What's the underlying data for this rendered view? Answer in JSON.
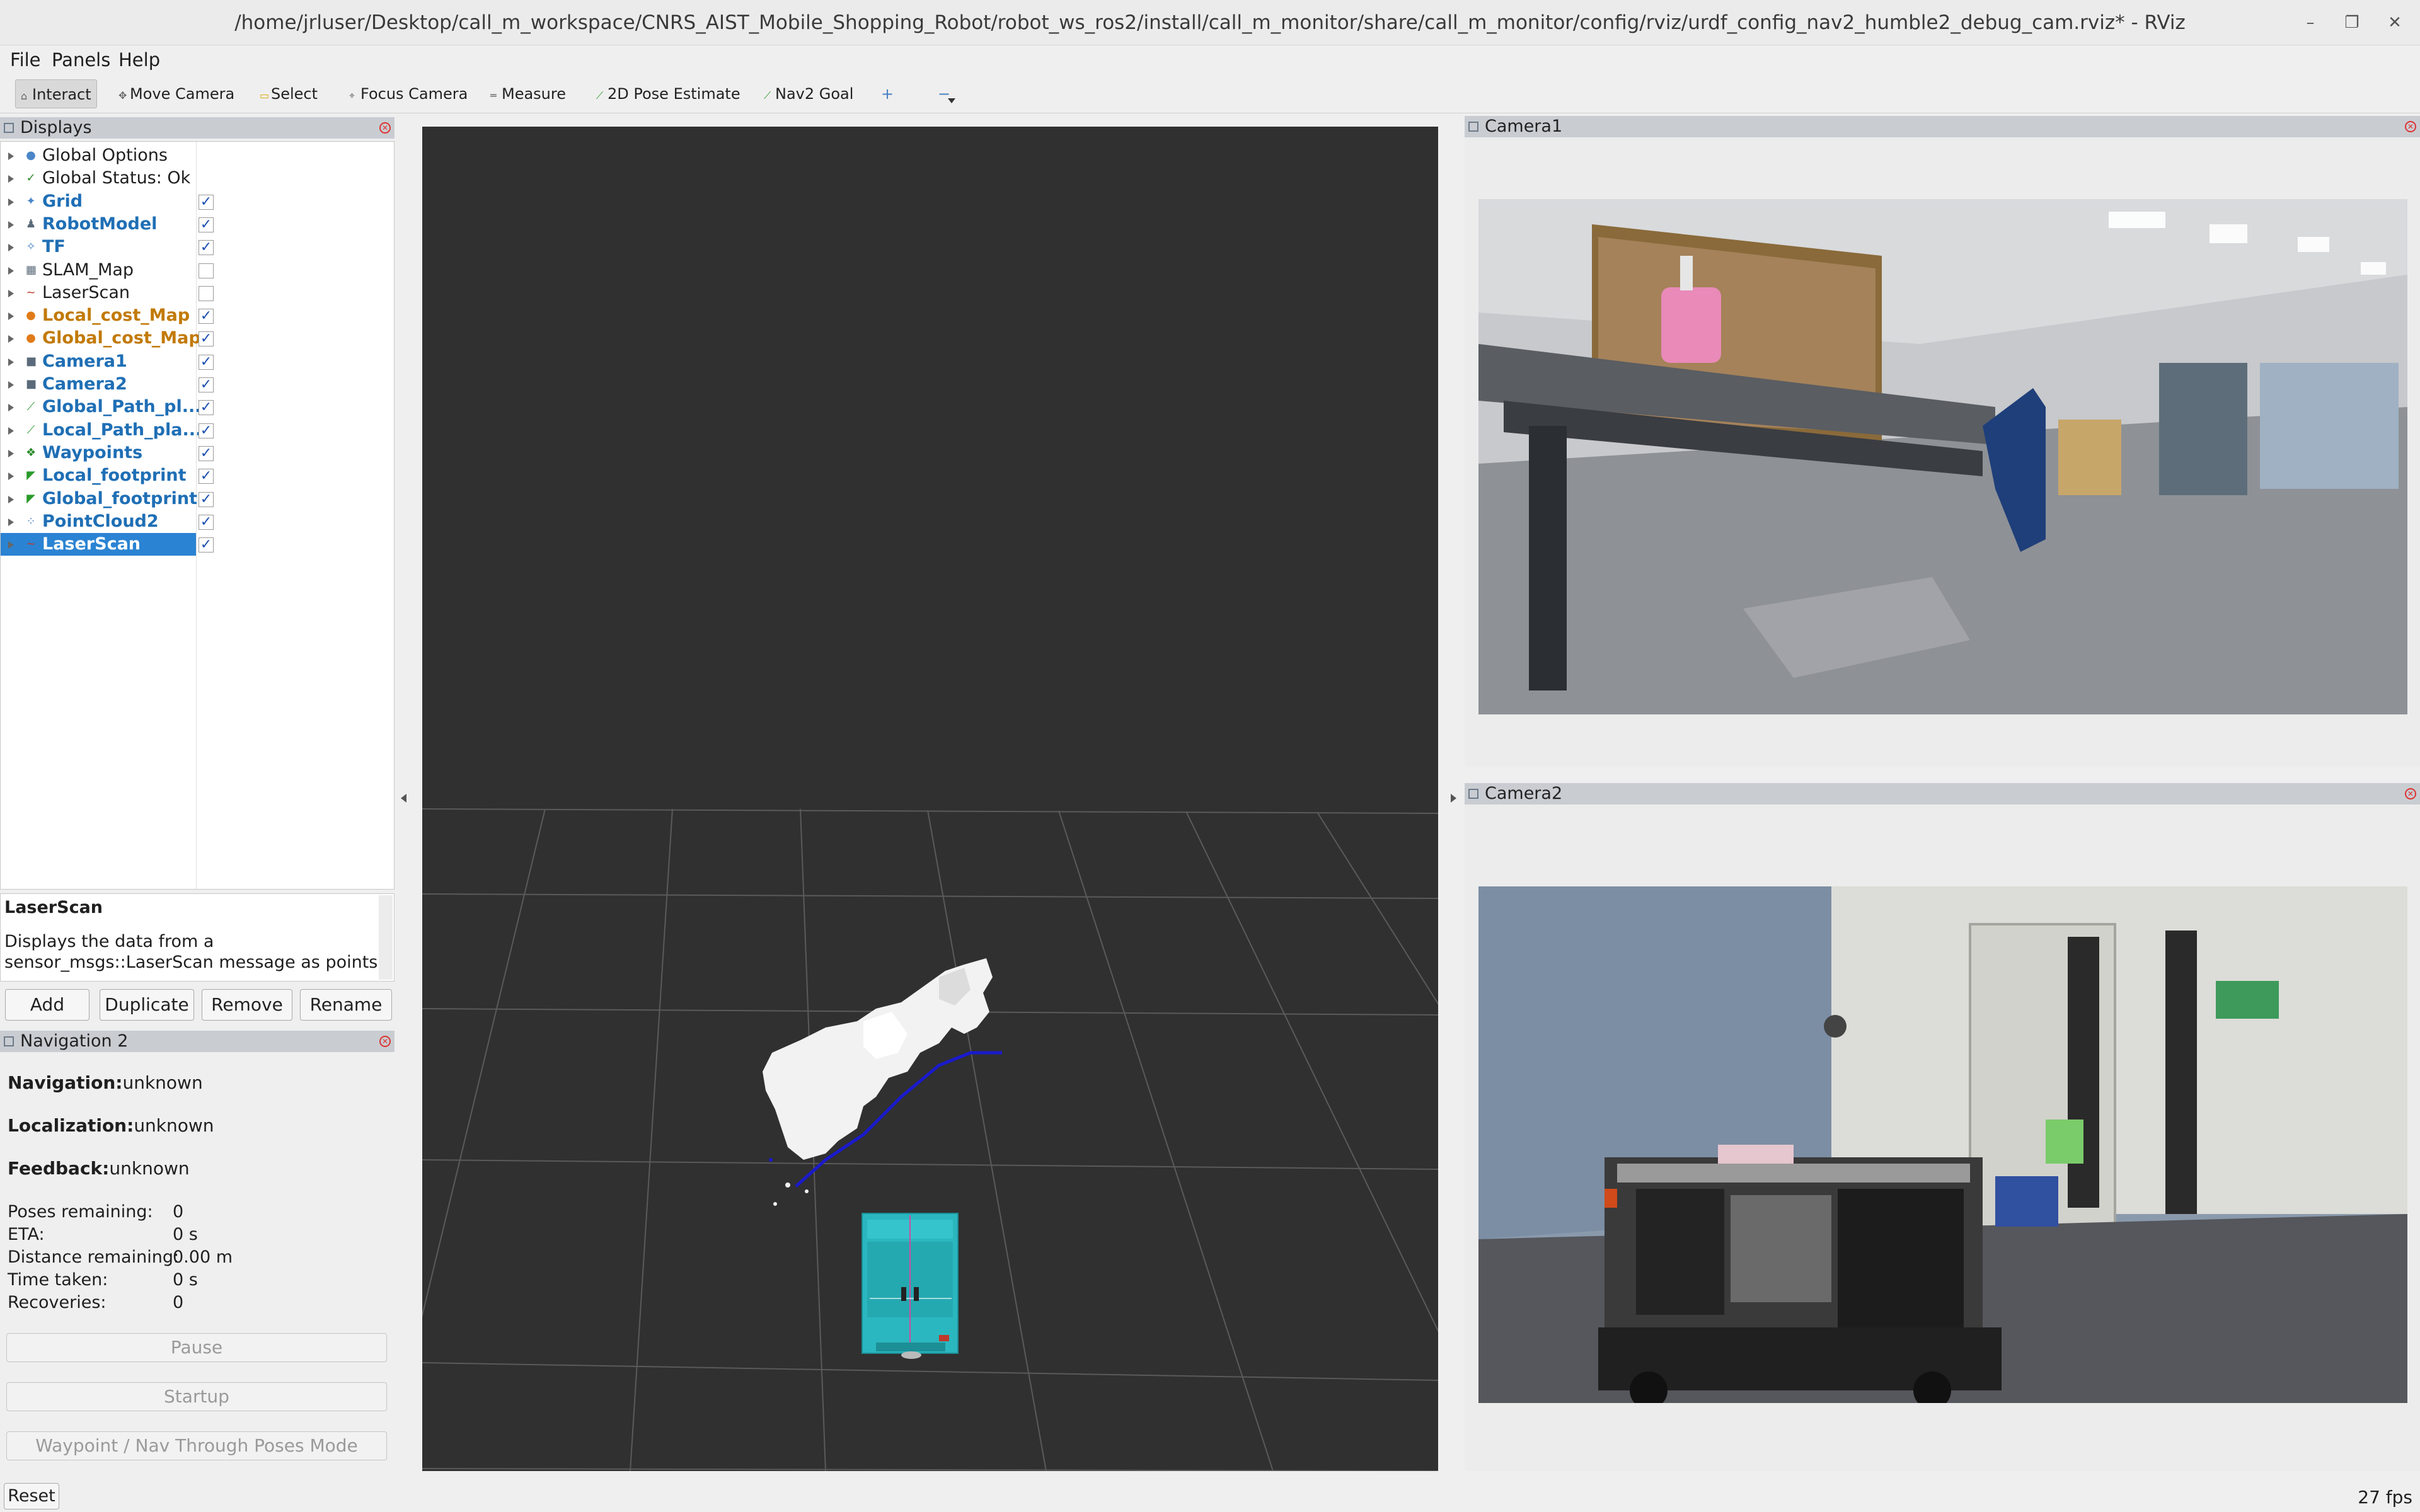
{
  "window": {
    "title": "/home/jrluser/Desktop/call_m_workspace/CNRS_AIST_Mobile_Shopping_Robot/robot_ws_ros2/install/call_m_monitor/share/call_m_monitor/config/rviz/urdf_config_nav2_humble2_debug_cam.rviz* - RViz",
    "minimize": "–",
    "restore": "❐",
    "close": "✕"
  },
  "menu": {
    "file": "File",
    "panels": "Panels",
    "help": "Help"
  },
  "toolbar": {
    "interact": "Interact",
    "move_camera": "Move Camera",
    "select": "Select",
    "focus_camera": "Focus Camera",
    "measure": "Measure",
    "pose_estimate": "2D Pose Estimate",
    "nav2_goal": "Nav2 Goal",
    "plus": "+",
    "minus": "−"
  },
  "displays": {
    "header": "Displays",
    "items": [
      {
        "label": "Global Options",
        "icon": "●",
        "icon_color": "#4a86c8",
        "bold": false,
        "color": "#1f1f1f",
        "check": null
      },
      {
        "label": "Global Status: Ok",
        "icon": "✓",
        "icon_color": "#2a8a2a",
        "bold": false,
        "color": "#1f1f1f",
        "check": null
      },
      {
        "label": "Grid",
        "icon": "✦",
        "icon_color": "#4a86c8",
        "bold": true,
        "color": "#1f6fb5",
        "check": "✓"
      },
      {
        "label": "RobotModel",
        "icon": "♟",
        "icon_color": "#5a6a7a",
        "bold": true,
        "color": "#1f6fb5",
        "check": "✓"
      },
      {
        "label": "TF",
        "icon": "✧",
        "icon_color": "#4a86c8",
        "bold": true,
        "color": "#1f6fb5",
        "check": "✓"
      },
      {
        "label": "SLAM_Map",
        "icon": "▦",
        "icon_color": "#5a6a7a",
        "bold": false,
        "color": "#1f1f1f",
        "check": ""
      },
      {
        "label": "LaserScan",
        "icon": "~",
        "icon_color": "#c0392b",
        "bold": false,
        "color": "#1f1f1f",
        "check": ""
      },
      {
        "label": "Local_cost_Map",
        "icon": "●",
        "icon_color": "#e07b1a",
        "bold": true,
        "color": "#c27a08",
        "check": "✓"
      },
      {
        "label": "Global_cost_Map",
        "icon": "●",
        "icon_color": "#e07b1a",
        "bold": true,
        "color": "#c27a08",
        "check": "✓"
      },
      {
        "label": "Camera1",
        "icon": "■",
        "icon_color": "#5a6a7a",
        "bold": true,
        "color": "#1f6fb5",
        "check": "✓"
      },
      {
        "label": "Camera2",
        "icon": "■",
        "icon_color": "#5a6a7a",
        "bold": true,
        "color": "#1f6fb5",
        "check": "✓"
      },
      {
        "label": "Global_Path_pl...",
        "icon": "⟋",
        "icon_color": "#2a9a2a",
        "bold": true,
        "color": "#1f6fb5",
        "check": "✓"
      },
      {
        "label": "Local_Path_pla...",
        "icon": "⟋",
        "icon_color": "#2a9a2a",
        "bold": true,
        "color": "#1f6fb5",
        "check": "✓"
      },
      {
        "label": "Waypoints",
        "icon": "❖",
        "icon_color": "#2a8a2a",
        "bold": true,
        "color": "#1f6fb5",
        "check": "✓"
      },
      {
        "label": "Local_footprint",
        "icon": "◤",
        "icon_color": "#2a9a2a",
        "bold": true,
        "color": "#1f6fb5",
        "check": "✓"
      },
      {
        "label": "Global_footprint",
        "icon": "◤",
        "icon_color": "#2a9a2a",
        "bold": true,
        "color": "#1f6fb5",
        "check": "✓"
      },
      {
        "label": "PointCloud2",
        "icon": "⁘",
        "icon_color": "#4a86c8",
        "bold": true,
        "color": "#1f6fb5",
        "check": "✓"
      },
      {
        "label": "LaserScan",
        "icon": "~",
        "icon_color": "#c0392b",
        "bold": true,
        "color": "#ffffff",
        "check": "✓",
        "selected": true
      }
    ]
  },
  "description": {
    "title": "LaserScan",
    "text": "Displays the data from a sensor_msgs::LaserScan message as points"
  },
  "display_buttons": {
    "add": "Add",
    "duplicate": "Duplicate",
    "remove": "Remove",
    "rename": "Rename"
  },
  "nav2": {
    "header": "Navigation 2",
    "navigation_label": "Navigation:",
    "navigation_value": "unknown",
    "localization_label": "Localization:",
    "localization_value": "unknown",
    "feedback_label": "Feedback:",
    "feedback_value": "unknown",
    "poses_remaining_label": "Poses remaining:",
    "poses_remaining_value": "0",
    "eta_label": "ETA:",
    "eta_value": "0 s",
    "distance_label": "Distance remaining:",
    "distance_value": "0.00 m",
    "time_label": "Time taken:",
    "time_value": "0 s",
    "recoveries_label": "Recoveries:",
    "recoveries_value": "0",
    "pause": "Pause",
    "startup": "Startup",
    "waypoint_mode": "Waypoint / Nav Through Poses Mode"
  },
  "cameras": {
    "camera1": "Camera1",
    "camera2": "Camera2"
  },
  "status": {
    "reset": "Reset",
    "fps": "27 fps"
  },
  "colors": {
    "viewport_bg": "#303030",
    "selection": "#2a83d3",
    "path_blue": "#1a1acc",
    "robot_cyan": "#2bb7bf",
    "dock_header": "#c9cdd2"
  }
}
